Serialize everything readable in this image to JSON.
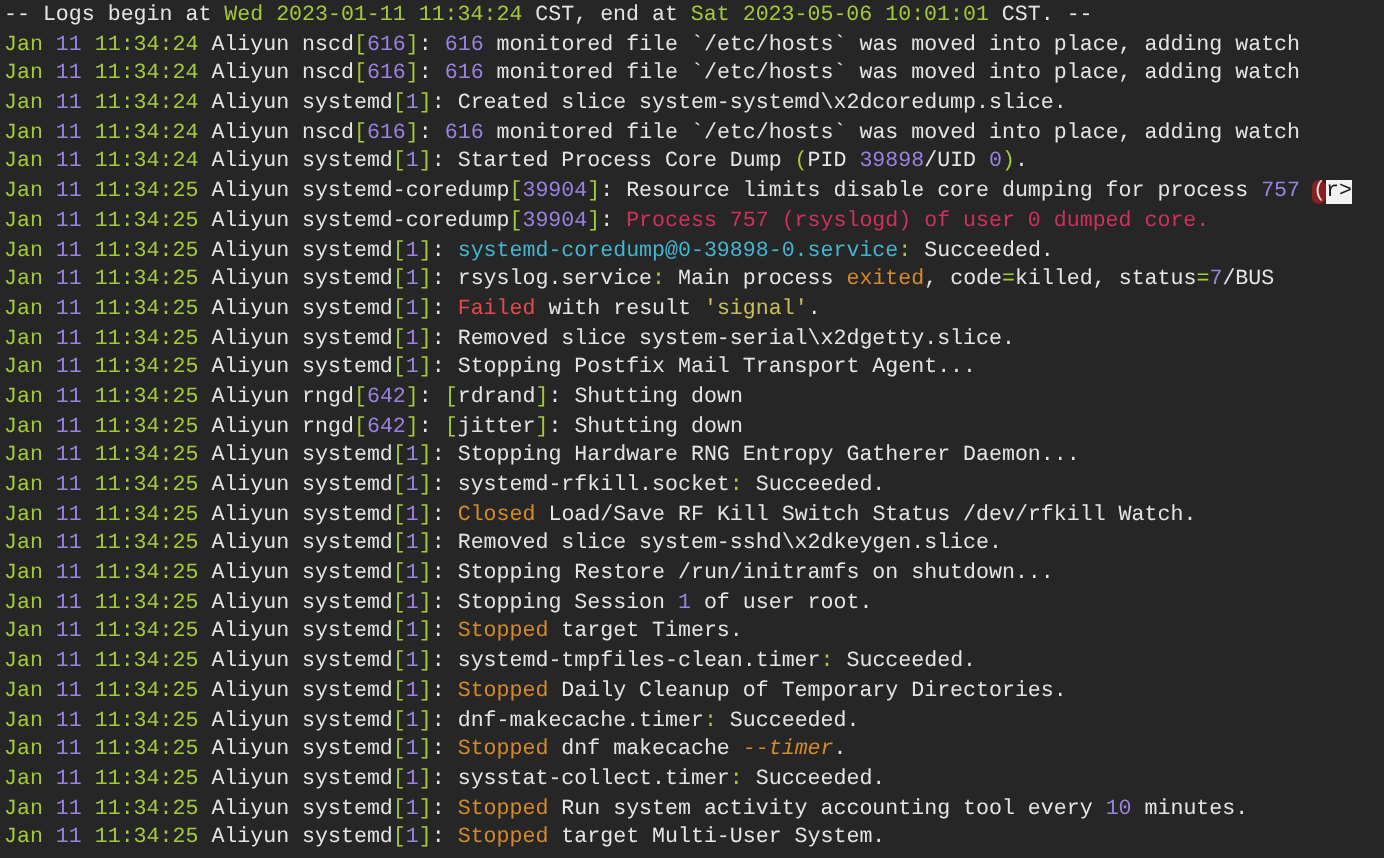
{
  "header": [
    {
      "kind": "plain",
      "text": "-- Logs begin at "
    },
    {
      "kind": "green",
      "text": "Wed 2023-01-11 11:34:24"
    },
    {
      "kind": "plain",
      "text": " CST, end at "
    },
    {
      "kind": "green",
      "text": "Sat 2023-05-06 10:01:01"
    },
    {
      "kind": "plain",
      "text": " CST. --"
    }
  ],
  "lines": [
    [
      {
        "kind": "green",
        "text": "Jan "
      },
      {
        "kind": "purple",
        "text": "11"
      },
      {
        "kind": "green",
        "text": " 11:34:24"
      },
      {
        "kind": "plain",
        "text": " Aliyun nscd"
      },
      {
        "kind": "green",
        "text": "["
      },
      {
        "kind": "purple",
        "text": "616"
      },
      {
        "kind": "green",
        "text": "]"
      },
      {
        "kind": "plain",
        "text": ": "
      },
      {
        "kind": "purple",
        "text": "616"
      },
      {
        "kind": "plain",
        "text": " monitored file `/etc/hosts` was moved into place, adding watch"
      }
    ],
    [
      {
        "kind": "green",
        "text": "Jan "
      },
      {
        "kind": "purple",
        "text": "11"
      },
      {
        "kind": "green",
        "text": " 11:34:24"
      },
      {
        "kind": "plain",
        "text": " Aliyun nscd"
      },
      {
        "kind": "green",
        "text": "["
      },
      {
        "kind": "purple",
        "text": "616"
      },
      {
        "kind": "green",
        "text": "]"
      },
      {
        "kind": "plain",
        "text": ": "
      },
      {
        "kind": "purple",
        "text": "616"
      },
      {
        "kind": "plain",
        "text": " monitored file `/etc/hosts` was moved into place, adding watch"
      }
    ],
    [
      {
        "kind": "green",
        "text": "Jan "
      },
      {
        "kind": "purple",
        "text": "11"
      },
      {
        "kind": "green",
        "text": " 11:34:24"
      },
      {
        "kind": "plain",
        "text": " Aliyun systemd"
      },
      {
        "kind": "green",
        "text": "["
      },
      {
        "kind": "purple",
        "text": "1"
      },
      {
        "kind": "green",
        "text": "]"
      },
      {
        "kind": "plain",
        "text": ": Created slice system-systemd\\x2dcoredump.slice."
      }
    ],
    [
      {
        "kind": "green",
        "text": "Jan "
      },
      {
        "kind": "purple",
        "text": "11"
      },
      {
        "kind": "green",
        "text": " 11:34:24"
      },
      {
        "kind": "plain",
        "text": " Aliyun nscd"
      },
      {
        "kind": "green",
        "text": "["
      },
      {
        "kind": "purple",
        "text": "616"
      },
      {
        "kind": "green",
        "text": "]"
      },
      {
        "kind": "plain",
        "text": ": "
      },
      {
        "kind": "purple",
        "text": "616"
      },
      {
        "kind": "plain",
        "text": " monitored file `/etc/hosts` was moved into place, adding watch"
      }
    ],
    [
      {
        "kind": "green",
        "text": "Jan "
      },
      {
        "kind": "purple",
        "text": "11"
      },
      {
        "kind": "green",
        "text": " 11:34:24"
      },
      {
        "kind": "plain",
        "text": " Aliyun systemd"
      },
      {
        "kind": "green",
        "text": "["
      },
      {
        "kind": "purple",
        "text": "1"
      },
      {
        "kind": "green",
        "text": "]"
      },
      {
        "kind": "plain",
        "text": ": Started Process Core Dump "
      },
      {
        "kind": "green",
        "text": "("
      },
      {
        "kind": "plain",
        "text": "PID "
      },
      {
        "kind": "purple",
        "text": "39898"
      },
      {
        "kind": "plain",
        "text": "/UID "
      },
      {
        "kind": "purple",
        "text": "0"
      },
      {
        "kind": "green",
        "text": ")"
      },
      {
        "kind": "plain",
        "text": "."
      }
    ],
    [
      {
        "kind": "green",
        "text": "Jan "
      },
      {
        "kind": "purple",
        "text": "11"
      },
      {
        "kind": "green",
        "text": " 11:34:25"
      },
      {
        "kind": "plain",
        "text": " Aliyun systemd-coredump"
      },
      {
        "kind": "green",
        "text": "["
      },
      {
        "kind": "purple",
        "text": "39904"
      },
      {
        "kind": "green",
        "text": "]"
      },
      {
        "kind": "plain",
        "text": ": Resource limits disable core dumping for process "
      },
      {
        "kind": "purple",
        "text": "757 "
      },
      {
        "kind": "match",
        "text": "("
      },
      {
        "kind": "cursor",
        "text": "r>"
      }
    ],
    [
      {
        "kind": "green",
        "text": "Jan "
      },
      {
        "kind": "purple",
        "text": "11"
      },
      {
        "kind": "green",
        "text": " 11:34:25"
      },
      {
        "kind": "plain",
        "text": " Aliyun systemd-coredump"
      },
      {
        "kind": "green",
        "text": "["
      },
      {
        "kind": "purple",
        "text": "39904"
      },
      {
        "kind": "green",
        "text": "]"
      },
      {
        "kind": "plain",
        "text": ": "
      },
      {
        "kind": "crimson",
        "text": "Process 757 (rsyslogd) of user 0 dumped core."
      }
    ],
    [
      {
        "kind": "green",
        "text": "Jan "
      },
      {
        "kind": "purple",
        "text": "11"
      },
      {
        "kind": "green",
        "text": " 11:34:25"
      },
      {
        "kind": "plain",
        "text": " Aliyun systemd"
      },
      {
        "kind": "green",
        "text": "["
      },
      {
        "kind": "purple",
        "text": "1"
      },
      {
        "kind": "green",
        "text": "]"
      },
      {
        "kind": "plain",
        "text": ": "
      },
      {
        "kind": "cyan",
        "text": "systemd-coredump@0-39898-0.service"
      },
      {
        "kind": "green",
        "text": ":"
      },
      {
        "kind": "plain",
        "text": " Succeeded."
      }
    ],
    [
      {
        "kind": "green",
        "text": "Jan "
      },
      {
        "kind": "purple",
        "text": "11"
      },
      {
        "kind": "green",
        "text": " 11:34:25"
      },
      {
        "kind": "plain",
        "text": " Aliyun systemd"
      },
      {
        "kind": "green",
        "text": "["
      },
      {
        "kind": "purple",
        "text": "1"
      },
      {
        "kind": "green",
        "text": "]"
      },
      {
        "kind": "plain",
        "text": ": rsyslog.service"
      },
      {
        "kind": "green",
        "text": ":"
      },
      {
        "kind": "plain",
        "text": " Main process "
      },
      {
        "kind": "orange",
        "text": "exited"
      },
      {
        "kind": "plain",
        "text": ", code"
      },
      {
        "kind": "green",
        "text": "="
      },
      {
        "kind": "plain",
        "text": "killed, status"
      },
      {
        "kind": "green",
        "text": "="
      },
      {
        "kind": "purple",
        "text": "7"
      },
      {
        "kind": "plain",
        "text": "/BUS"
      }
    ],
    [
      {
        "kind": "green",
        "text": "Jan "
      },
      {
        "kind": "purple",
        "text": "11"
      },
      {
        "kind": "green",
        "text": " 11:34:25"
      },
      {
        "kind": "plain",
        "text": " Aliyun systemd"
      },
      {
        "kind": "green",
        "text": "["
      },
      {
        "kind": "purple",
        "text": "1"
      },
      {
        "kind": "green",
        "text": "]"
      },
      {
        "kind": "plain",
        "text": ": "
      },
      {
        "kind": "red",
        "text": "Failed"
      },
      {
        "kind": "plain",
        "text": " with result "
      },
      {
        "kind": "yellow",
        "text": "'signal'"
      },
      {
        "kind": "plain",
        "text": "."
      }
    ],
    [
      {
        "kind": "green",
        "text": "Jan "
      },
      {
        "kind": "purple",
        "text": "11"
      },
      {
        "kind": "green",
        "text": " 11:34:25"
      },
      {
        "kind": "plain",
        "text": " Aliyun systemd"
      },
      {
        "kind": "green",
        "text": "["
      },
      {
        "kind": "purple",
        "text": "1"
      },
      {
        "kind": "green",
        "text": "]"
      },
      {
        "kind": "plain",
        "text": ": Removed slice system-serial\\x2dgetty.slice."
      }
    ],
    [
      {
        "kind": "green",
        "text": "Jan "
      },
      {
        "kind": "purple",
        "text": "11"
      },
      {
        "kind": "green",
        "text": " 11:34:25"
      },
      {
        "kind": "plain",
        "text": " Aliyun systemd"
      },
      {
        "kind": "green",
        "text": "["
      },
      {
        "kind": "purple",
        "text": "1"
      },
      {
        "kind": "green",
        "text": "]"
      },
      {
        "kind": "plain",
        "text": ": Stopping Postfix Mail Transport Agent..."
      }
    ],
    [
      {
        "kind": "green",
        "text": "Jan "
      },
      {
        "kind": "purple",
        "text": "11"
      },
      {
        "kind": "green",
        "text": " 11:34:25"
      },
      {
        "kind": "plain",
        "text": " Aliyun rngd"
      },
      {
        "kind": "green",
        "text": "["
      },
      {
        "kind": "purple",
        "text": "642"
      },
      {
        "kind": "green",
        "text": "]"
      },
      {
        "kind": "plain",
        "text": ": "
      },
      {
        "kind": "green",
        "text": "["
      },
      {
        "kind": "plain",
        "text": "rdrand"
      },
      {
        "kind": "green",
        "text": "]"
      },
      {
        "kind": "plain",
        "text": ": Shutting down"
      }
    ],
    [
      {
        "kind": "green",
        "text": "Jan "
      },
      {
        "kind": "purple",
        "text": "11"
      },
      {
        "kind": "green",
        "text": " 11:34:25"
      },
      {
        "kind": "plain",
        "text": " Aliyun rngd"
      },
      {
        "kind": "green",
        "text": "["
      },
      {
        "kind": "purple",
        "text": "642"
      },
      {
        "kind": "green",
        "text": "]"
      },
      {
        "kind": "plain",
        "text": ": "
      },
      {
        "kind": "green",
        "text": "["
      },
      {
        "kind": "plain",
        "text": "jitter"
      },
      {
        "kind": "green",
        "text": "]"
      },
      {
        "kind": "plain",
        "text": ": Shutting down"
      }
    ],
    [
      {
        "kind": "green",
        "text": "Jan "
      },
      {
        "kind": "purple",
        "text": "11"
      },
      {
        "kind": "green",
        "text": " 11:34:25"
      },
      {
        "kind": "plain",
        "text": " Aliyun systemd"
      },
      {
        "kind": "green",
        "text": "["
      },
      {
        "kind": "purple",
        "text": "1"
      },
      {
        "kind": "green",
        "text": "]"
      },
      {
        "kind": "plain",
        "text": ": Stopping Hardware RNG Entropy Gatherer Daemon..."
      }
    ],
    [
      {
        "kind": "green",
        "text": "Jan "
      },
      {
        "kind": "purple",
        "text": "11"
      },
      {
        "kind": "green",
        "text": " 11:34:25"
      },
      {
        "kind": "plain",
        "text": " Aliyun systemd"
      },
      {
        "kind": "green",
        "text": "["
      },
      {
        "kind": "purple",
        "text": "1"
      },
      {
        "kind": "green",
        "text": "]"
      },
      {
        "kind": "plain",
        "text": ": systemd-rfkill.socket"
      },
      {
        "kind": "green",
        "text": ":"
      },
      {
        "kind": "plain",
        "text": " Succeeded."
      }
    ],
    [
      {
        "kind": "green",
        "text": "Jan "
      },
      {
        "kind": "purple",
        "text": "11"
      },
      {
        "kind": "green",
        "text": " 11:34:25"
      },
      {
        "kind": "plain",
        "text": " Aliyun systemd"
      },
      {
        "kind": "green",
        "text": "["
      },
      {
        "kind": "purple",
        "text": "1"
      },
      {
        "kind": "green",
        "text": "]"
      },
      {
        "kind": "plain",
        "text": ": "
      },
      {
        "kind": "orange",
        "text": "Closed"
      },
      {
        "kind": "plain",
        "text": " Load/Save RF Kill Switch Status /dev/rfkill Watch."
      }
    ],
    [
      {
        "kind": "green",
        "text": "Jan "
      },
      {
        "kind": "purple",
        "text": "11"
      },
      {
        "kind": "green",
        "text": " 11:34:25"
      },
      {
        "kind": "plain",
        "text": " Aliyun systemd"
      },
      {
        "kind": "green",
        "text": "["
      },
      {
        "kind": "purple",
        "text": "1"
      },
      {
        "kind": "green",
        "text": "]"
      },
      {
        "kind": "plain",
        "text": ": Removed slice system-sshd\\x2dkeygen.slice."
      }
    ],
    [
      {
        "kind": "green",
        "text": "Jan "
      },
      {
        "kind": "purple",
        "text": "11"
      },
      {
        "kind": "green",
        "text": " 11:34:25"
      },
      {
        "kind": "plain",
        "text": " Aliyun systemd"
      },
      {
        "kind": "green",
        "text": "["
      },
      {
        "kind": "purple",
        "text": "1"
      },
      {
        "kind": "green",
        "text": "]"
      },
      {
        "kind": "plain",
        "text": ": Stopping Restore /run/initramfs on shutdown..."
      }
    ],
    [
      {
        "kind": "green",
        "text": "Jan "
      },
      {
        "kind": "purple",
        "text": "11"
      },
      {
        "kind": "green",
        "text": " 11:34:25"
      },
      {
        "kind": "plain",
        "text": " Aliyun systemd"
      },
      {
        "kind": "green",
        "text": "["
      },
      {
        "kind": "purple",
        "text": "1"
      },
      {
        "kind": "green",
        "text": "]"
      },
      {
        "kind": "plain",
        "text": ": Stopping Session "
      },
      {
        "kind": "purple",
        "text": "1"
      },
      {
        "kind": "plain",
        "text": " of user root."
      }
    ],
    [
      {
        "kind": "green",
        "text": "Jan "
      },
      {
        "kind": "purple",
        "text": "11"
      },
      {
        "kind": "green",
        "text": " 11:34:25"
      },
      {
        "kind": "plain",
        "text": " Aliyun systemd"
      },
      {
        "kind": "green",
        "text": "["
      },
      {
        "kind": "purple",
        "text": "1"
      },
      {
        "kind": "green",
        "text": "]"
      },
      {
        "kind": "plain",
        "text": ": "
      },
      {
        "kind": "orange",
        "text": "Stopped"
      },
      {
        "kind": "plain",
        "text": " target Timers."
      }
    ],
    [
      {
        "kind": "green",
        "text": "Jan "
      },
      {
        "kind": "purple",
        "text": "11"
      },
      {
        "kind": "green",
        "text": " 11:34:25"
      },
      {
        "kind": "plain",
        "text": " Aliyun systemd"
      },
      {
        "kind": "green",
        "text": "["
      },
      {
        "kind": "purple",
        "text": "1"
      },
      {
        "kind": "green",
        "text": "]"
      },
      {
        "kind": "plain",
        "text": ": systemd-tmpfiles-clean.timer"
      },
      {
        "kind": "green",
        "text": ":"
      },
      {
        "kind": "plain",
        "text": " Succeeded."
      }
    ],
    [
      {
        "kind": "green",
        "text": "Jan "
      },
      {
        "kind": "purple",
        "text": "11"
      },
      {
        "kind": "green",
        "text": " 11:34:25"
      },
      {
        "kind": "plain",
        "text": " Aliyun systemd"
      },
      {
        "kind": "green",
        "text": "["
      },
      {
        "kind": "purple",
        "text": "1"
      },
      {
        "kind": "green",
        "text": "]"
      },
      {
        "kind": "plain",
        "text": ": "
      },
      {
        "kind": "orange",
        "text": "Stopped"
      },
      {
        "kind": "plain",
        "text": " Daily Cleanup of Temporary Directories."
      }
    ],
    [
      {
        "kind": "green",
        "text": "Jan "
      },
      {
        "kind": "purple",
        "text": "11"
      },
      {
        "kind": "green",
        "text": " 11:34:25"
      },
      {
        "kind": "plain",
        "text": " Aliyun systemd"
      },
      {
        "kind": "green",
        "text": "["
      },
      {
        "kind": "purple",
        "text": "1"
      },
      {
        "kind": "green",
        "text": "]"
      },
      {
        "kind": "plain",
        "text": ": dnf-makecache.timer"
      },
      {
        "kind": "green",
        "text": ":"
      },
      {
        "kind": "plain",
        "text": " Succeeded."
      }
    ],
    [
      {
        "kind": "green",
        "text": "Jan "
      },
      {
        "kind": "purple",
        "text": "11"
      },
      {
        "kind": "green",
        "text": " 11:34:25"
      },
      {
        "kind": "plain",
        "text": " Aliyun systemd"
      },
      {
        "kind": "green",
        "text": "["
      },
      {
        "kind": "purple",
        "text": "1"
      },
      {
        "kind": "green",
        "text": "]"
      },
      {
        "kind": "plain",
        "text": ": "
      },
      {
        "kind": "orange",
        "text": "Stopped"
      },
      {
        "kind": "plain",
        "text": " dnf makecache "
      },
      {
        "kind": "italic",
        "text": "--timer"
      },
      {
        "kind": "plain",
        "text": "."
      }
    ],
    [
      {
        "kind": "green",
        "text": "Jan "
      },
      {
        "kind": "purple",
        "text": "11"
      },
      {
        "kind": "green",
        "text": " 11:34:25"
      },
      {
        "kind": "plain",
        "text": " Aliyun systemd"
      },
      {
        "kind": "green",
        "text": "["
      },
      {
        "kind": "purple",
        "text": "1"
      },
      {
        "kind": "green",
        "text": "]"
      },
      {
        "kind": "plain",
        "text": ": sysstat-collect.timer"
      },
      {
        "kind": "green",
        "text": ":"
      },
      {
        "kind": "plain",
        "text": " Succeeded."
      }
    ],
    [
      {
        "kind": "green",
        "text": "Jan "
      },
      {
        "kind": "purple",
        "text": "11"
      },
      {
        "kind": "green",
        "text": " 11:34:25"
      },
      {
        "kind": "plain",
        "text": " Aliyun systemd"
      },
      {
        "kind": "green",
        "text": "["
      },
      {
        "kind": "purple",
        "text": "1"
      },
      {
        "kind": "green",
        "text": "]"
      },
      {
        "kind": "plain",
        "text": ": "
      },
      {
        "kind": "orange",
        "text": "Stopped"
      },
      {
        "kind": "plain",
        "text": " Run system activity accounting tool every "
      },
      {
        "kind": "purple",
        "text": "10"
      },
      {
        "kind": "plain",
        "text": " minutes."
      }
    ],
    [
      {
        "kind": "green",
        "text": "Jan "
      },
      {
        "kind": "purple",
        "text": "11"
      },
      {
        "kind": "green",
        "text": " 11:34:25"
      },
      {
        "kind": "plain",
        "text": " Aliyun systemd"
      },
      {
        "kind": "green",
        "text": "["
      },
      {
        "kind": "purple",
        "text": "1"
      },
      {
        "kind": "green",
        "text": "]"
      },
      {
        "kind": "plain",
        "text": ": "
      },
      {
        "kind": "orange",
        "text": "Stopped"
      },
      {
        "kind": "plain",
        "text": " target Multi-User System."
      }
    ]
  ]
}
